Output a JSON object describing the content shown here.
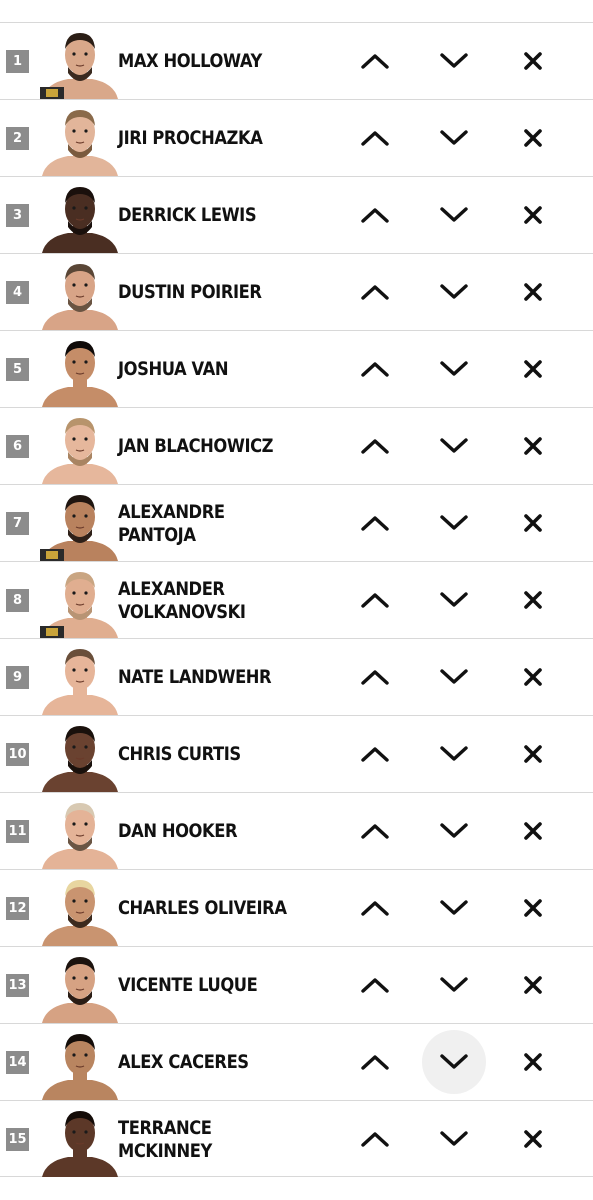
{
  "rankings": [
    {
      "rank": "1",
      "name": "MAX HOLLOWAY",
      "skin": "#d9a88a",
      "hair": "#2b1e16",
      "beard": "#3a2a20",
      "belt": true
    },
    {
      "rank": "2",
      "name": "JIRI PROCHAZKA",
      "skin": "#e2b59a",
      "hair": "#8a6a4a",
      "beard": "#7a5a3e",
      "belt": false
    },
    {
      "rank": "3",
      "name": "DERRICK LEWIS",
      "skin": "#4a2e22",
      "hair": "#1a100c",
      "beard": "#1a100c",
      "belt": false
    },
    {
      "rank": "4",
      "name": "DUSTIN POIRIER",
      "skin": "#d8a487",
      "hair": "#5a4636",
      "beard": "#6a5442",
      "belt": false
    },
    {
      "rank": "5",
      "name": "JOSHUA VAN",
      "skin": "#c58d68",
      "hair": "#0f0a08",
      "beard": null,
      "belt": false
    },
    {
      "rank": "6",
      "name": "JAN BLACHOWICZ",
      "skin": "#e6b79c",
      "hair": "#b8946c",
      "beard": "#a98462",
      "belt": false
    },
    {
      "rank": "7",
      "name": "ALEXANDRE PANTOJA",
      "skin": "#b9825e",
      "hair": "#1f1510",
      "beard": "#2e2018",
      "belt": true
    },
    {
      "rank": "8",
      "name": "ALEXANDER VOLKANOVSKI",
      "skin": "#e0ae90",
      "hair": "#c9a582",
      "beard": "#b89474",
      "belt": true
    },
    {
      "rank": "9",
      "name": "NATE LANDWEHR",
      "skin": "#e6b599",
      "hair": "#6a4f3a",
      "beard": null,
      "belt": false
    },
    {
      "rank": "10",
      "name": "CHRIS CURTIS",
      "skin": "#6a4230",
      "hair": "#1a110c",
      "beard": "#1a110c",
      "belt": false
    },
    {
      "rank": "11",
      "name": "DAN HOOKER",
      "skin": "#e4b397",
      "hair": "#d8c9b2",
      "beard": "#6a5544",
      "belt": false
    },
    {
      "rank": "12",
      "name": "CHARLES OLIVEIRA",
      "skin": "#c99470",
      "hair": "#e8d6a0",
      "beard": "#3b2a1e",
      "belt": false
    },
    {
      "rank": "13",
      "name": "VICENTE LUQUE",
      "skin": "#d6a283",
      "hair": "#1c130e",
      "beard": "#2a1c14",
      "belt": false
    },
    {
      "rank": "14",
      "name": "ALEX CACERES",
      "skin": "#b98560",
      "hair": "#140d09",
      "beard": null,
      "belt": false,
      "down_hover": true
    },
    {
      "rank": "15",
      "name": "TERRANCE MCKINNEY",
      "skin": "#5c3828",
      "hair": "#140c08",
      "beard": null,
      "belt": false
    }
  ],
  "icons": {
    "up": "chevron-up-icon",
    "down": "chevron-down-icon",
    "remove": "close-icon"
  },
  "colors": {
    "rank_badge": "#8c8c8c",
    "divider": "#d8d8d8",
    "icon": "#111111",
    "hover": "#f0f0f0"
  }
}
